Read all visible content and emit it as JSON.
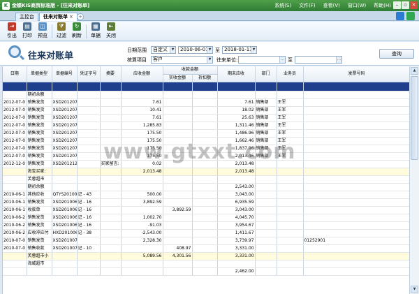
{
  "app": {
    "title": "金蝶KIS商贸标准版 - [往来对账单]",
    "logo_text": "K",
    "menus": [
      "系统(S)",
      "文件(F)",
      "查看(V)",
      "窗口(W)",
      "帮助(H)"
    ],
    "win_buttons": [
      "–",
      "▫",
      "✕"
    ]
  },
  "tabs": [
    {
      "label": "主控台",
      "close": ""
    },
    {
      "label": "往来对账单",
      "close": "×"
    }
  ],
  "tab_plus": "+",
  "toolbar": [
    {
      "label": "引出",
      "icon": "export-icon",
      "glyph": "⇥",
      "color": "#c0392b"
    },
    {
      "label": "打印",
      "icon": "printer-icon",
      "glyph": "▤",
      "color": "#4a6f93"
    },
    {
      "label": "预览",
      "icon": "preview-icon",
      "glyph": "◫",
      "color": "#5a8fc4"
    },
    {
      "label": "过滤",
      "icon": "filter-icon",
      "glyph": "⧩",
      "color": "#8a7a2e"
    },
    {
      "label": "刷新",
      "icon": "refresh-icon",
      "glyph": "↻",
      "color": "#3a8a3a"
    },
    {
      "label": "单据",
      "icon": "document-icon",
      "glyph": "▦",
      "color": "#4a6f93"
    },
    {
      "label": "关闭",
      "icon": "close-door-icon",
      "glyph": "⇤",
      "color": "#5c7d3a"
    }
  ],
  "page_title": "往来对账单",
  "filter": {
    "date_range_label": "日期范围",
    "date_mode": "自定义",
    "date_from": "2010-06-01",
    "to_label": "至",
    "date_to": "2018-01-13",
    "project_label": "核算项目",
    "project_value": "客户",
    "unit_label": "往来单位:",
    "unit_from": "",
    "unit_to_label": "至",
    "unit_to": "",
    "query_label": "查询"
  },
  "table": {
    "group_header": "收款金额",
    "columns": [
      "日期",
      "单据类型",
      "单据编号",
      "凭证字号",
      "摘要",
      "应收金额",
      "实收金额",
      "折扣额",
      "期末应收",
      "部门",
      "业务员",
      "发票号码"
    ],
    "rows": [
      {
        "type": "blue",
        "cells": [
          "",
          "",
          "",
          "",
          "",
          "",
          "",
          "",
          "",
          "",
          "",
          ""
        ]
      },
      {
        "cells": [
          "",
          "期初余额",
          "",
          "",
          "",
          "",
          "",
          "",
          "",
          "",
          "",
          ""
        ]
      },
      {
        "cells": [
          "2012-07-0",
          "销售发货",
          "XSD201207",
          "",
          "",
          "7.61",
          "",
          "",
          "7.61",
          "销售部",
          "王军",
          ""
        ]
      },
      {
        "cells": [
          "2012-07-0",
          "销售发货",
          "XSD201207",
          "",
          "",
          "10.41",
          "",
          "",
          "18.02",
          "销售部",
          "王军",
          ""
        ]
      },
      {
        "cells": [
          "2012-07-0",
          "销售发货",
          "XSD201207",
          "",
          "",
          "7.61",
          "",
          "",
          "25.63",
          "销售部",
          "王军",
          ""
        ]
      },
      {
        "cells": [
          "2012-07-0",
          "销售发货",
          "XSD201207",
          "",
          "",
          "1,285.83",
          "",
          "",
          "1,311.46",
          "销售部",
          "王军",
          ""
        ]
      },
      {
        "cells": [
          "2012-07-0",
          "销售发货",
          "XSD201207",
          "",
          "",
          "175.50",
          "",
          "",
          "1,486.96",
          "销售部",
          "王军",
          ""
        ]
      },
      {
        "cells": [
          "2012-07-0",
          "销售发货",
          "XSD201207",
          "",
          "",
          "175.50",
          "",
          "",
          "1,662.46",
          "销售部",
          "王军",
          ""
        ]
      },
      {
        "cells": [
          "2012-07-0",
          "销售发货",
          "XSD201207",
          "",
          "",
          "175.50",
          "",
          "",
          "1,837.96",
          "销售部",
          "王军",
          ""
        ]
      },
      {
        "cells": [
          "2012-07-0",
          "销售发货",
          "XSD201207",
          "",
          "",
          "175.50",
          "",
          "",
          "2,013.46",
          "销售部",
          "王军",
          ""
        ]
      },
      {
        "cells": [
          "2012-12-0",
          "销售发货",
          "XSD201212",
          "",
          "买家留言:",
          "0.02",
          "",
          "",
          "2,013.48",
          "",
          "",
          ""
        ]
      },
      {
        "type": "yellow",
        "cells": [
          "",
          "淘宝买家:",
          "",
          "",
          "",
          "2,013.48",
          "",
          "",
          "2,013.48",
          "",
          "",
          ""
        ]
      },
      {
        "cells": [
          "",
          "芙蓉超市",
          "",
          "",
          "",
          "",
          "",
          "",
          "",
          "",
          "",
          ""
        ]
      },
      {
        "cells": [
          "",
          "期初余额",
          "",
          "",
          "",
          "",
          "",
          "",
          "2,543.00",
          "",
          "",
          ""
        ]
      },
      {
        "cells": [
          "2010-06-1",
          "其他应收",
          "QTYS20100",
          "记 - 43",
          "",
          "500.00",
          "",
          "",
          "3,043.00",
          "",
          "",
          ""
        ]
      },
      {
        "cells": [
          "2010-06-1",
          "销售发货",
          "XSD201006",
          "记 - 16",
          "",
          "3,892.59",
          "",
          "",
          "6,935.59",
          "",
          "",
          ""
        ]
      },
      {
        "cells": [
          "2010-06-1",
          "收款单",
          "XSD201006",
          "记 - 16",
          "",
          "",
          "3,892.59",
          "",
          "3,043.00",
          "",
          "",
          ""
        ]
      },
      {
        "cells": [
          "2010-06-2",
          "销售发货",
          "XSD201006",
          "记 - 16",
          "",
          "1,002.70",
          "",
          "",
          "4,045.70",
          "",
          "",
          ""
        ]
      },
      {
        "cells": [
          "2010-06-2",
          "销售发货",
          "XSD201006",
          "记 - 16",
          "",
          "-91.03",
          "",
          "",
          "3,954.67",
          "",
          "",
          ""
        ]
      },
      {
        "cells": [
          "2010-06-2",
          "应收冲应付",
          "HXD201006",
          "记 - 38",
          "",
          "-2,543.00",
          "",
          "",
          "1,411.67",
          "",
          "",
          ""
        ]
      },
      {
        "cells": [
          "2010-07-0",
          "销售发货",
          "XSD201007",
          "",
          "",
          "2,328.30",
          "",
          "",
          "3,739.97",
          "",
          "",
          "01252901"
        ]
      },
      {
        "cells": [
          "2010-07-0",
          "销售收款",
          "XSD201007",
          "记 - 10",
          "",
          "",
          "408.97",
          "",
          "3,331.00",
          "",
          "",
          ""
        ]
      },
      {
        "type": "yellow",
        "cells": [
          "",
          "芙蓉超市小",
          "",
          "",
          "",
          "5,089.56",
          "4,301.56",
          "",
          "3,331.00",
          "",
          "",
          ""
        ]
      },
      {
        "cells": [
          "",
          "海威超市",
          "",
          "",
          "",
          "",
          "",
          "",
          "",
          "",
          "",
          ""
        ]
      },
      {
        "cells": [
          "",
          "",
          "",
          "",
          "",
          "",
          "",
          "",
          "2,462.00",
          "",
          "",
          ""
        ]
      }
    ]
  },
  "watermark": "www.gtxxt.com"
}
